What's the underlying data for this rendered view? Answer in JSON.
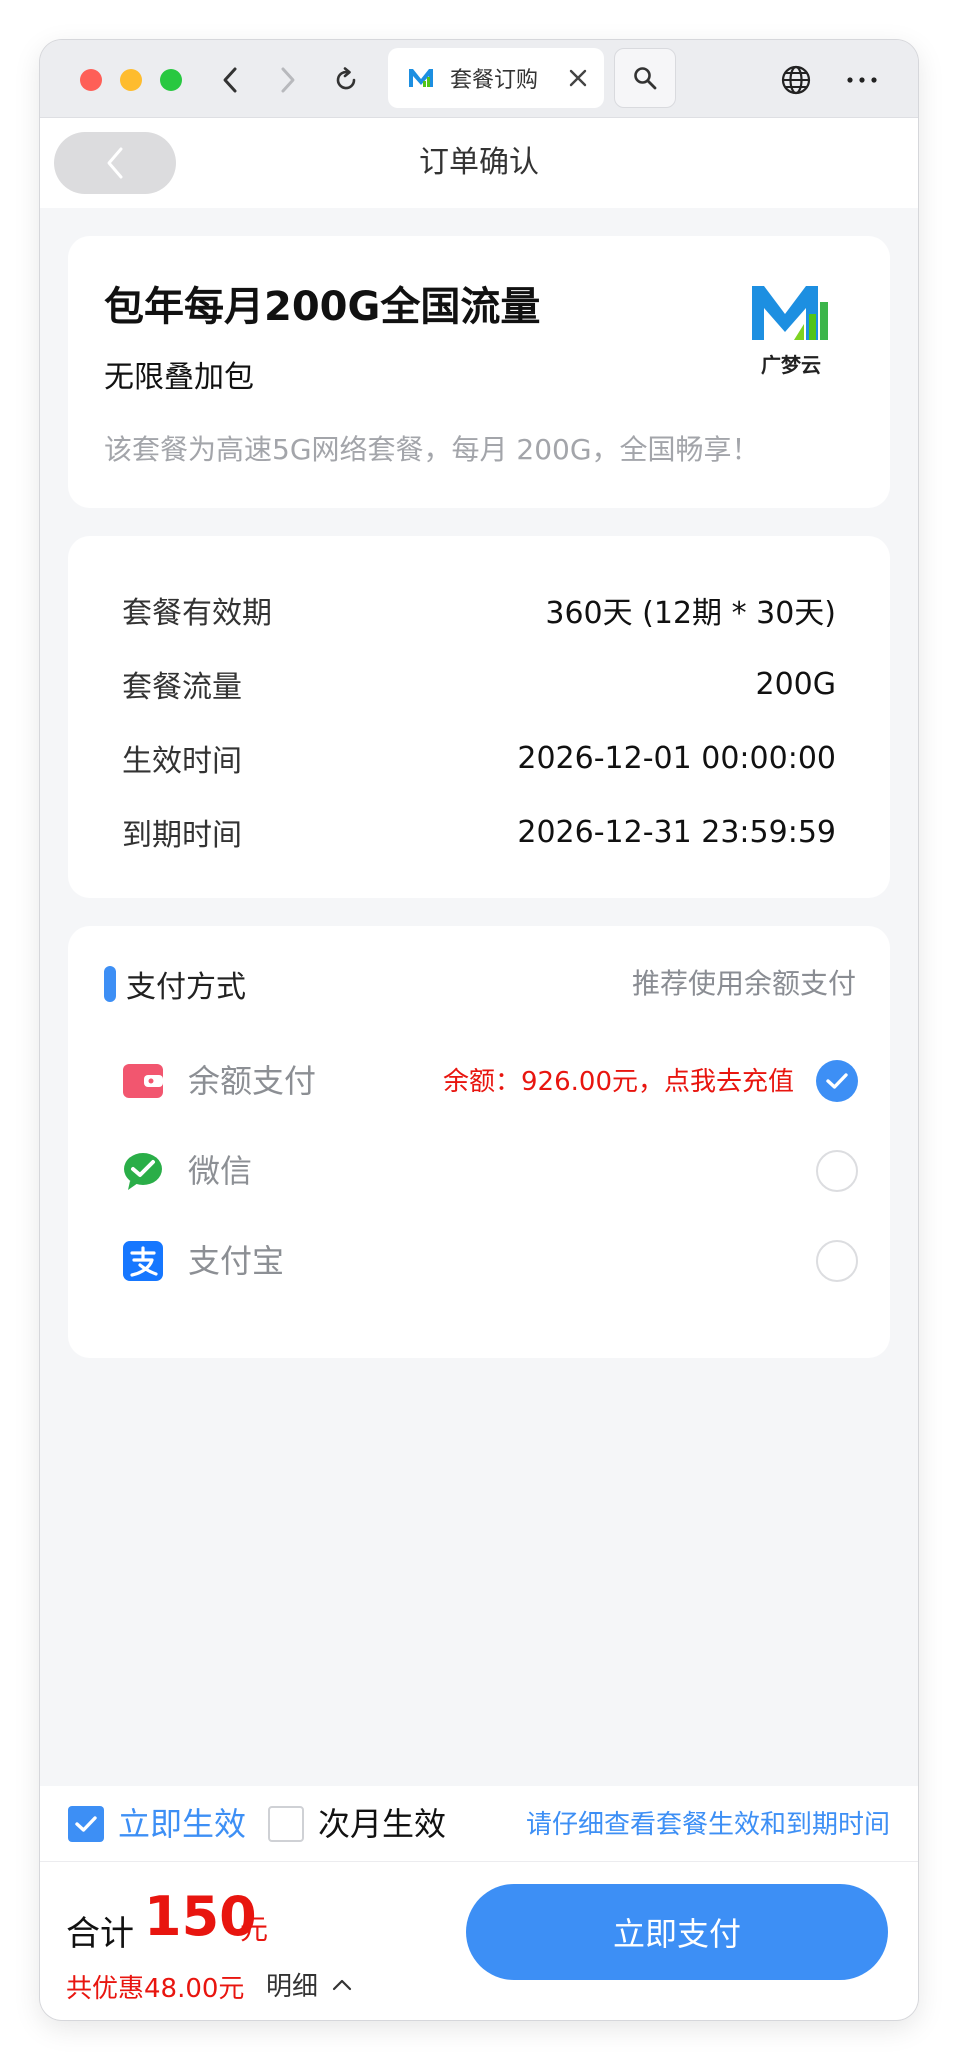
{
  "browser": {
    "tab_title": "套餐订购"
  },
  "header": {
    "title": "订单确认"
  },
  "product": {
    "title": "包年每月200G全国流量",
    "subtitle": "无限叠加包",
    "description": "该套餐为高速5G网络套餐，每月 200G，全国畅享！",
    "brand_logo_text": "广梦云"
  },
  "info": [
    {
      "label": "套餐有效期",
      "value": "360天 (12期 * 30天)"
    },
    {
      "label": "套餐流量",
      "value": "200G"
    },
    {
      "label": "生效时间",
      "value": "2026-12-01 00:00:00"
    },
    {
      "label": "到期时间",
      "value": "2026-12-31 23:59:59"
    }
  ],
  "payment": {
    "title": "支付方式",
    "hint": "推荐使用余额支付",
    "methods": [
      {
        "label": "余额支付",
        "icon": "wallet-icon",
        "balance": "余额：926.00元，点我去充值",
        "selected": true
      },
      {
        "label": "微信",
        "icon": "wechat-icon",
        "selected": false
      },
      {
        "label": "支付宝",
        "icon": "alipay-icon",
        "selected": false
      }
    ]
  },
  "effective": {
    "immediate_label": "立即生效",
    "immediate_checked": true,
    "next_month_label": "次月生效",
    "next_month_checked": false,
    "note": "请仔细查看套餐生效和到期时间"
  },
  "footer": {
    "total_label": "合计",
    "total_amount": "150",
    "total_unit": "元",
    "discount": "共优惠48.00元",
    "detail_label": "明细",
    "pay_button": "立即支付"
  },
  "colors": {
    "accent": "#3d8ff5",
    "price_red": "#e8150f",
    "page_bg": "#f5f6f8"
  }
}
